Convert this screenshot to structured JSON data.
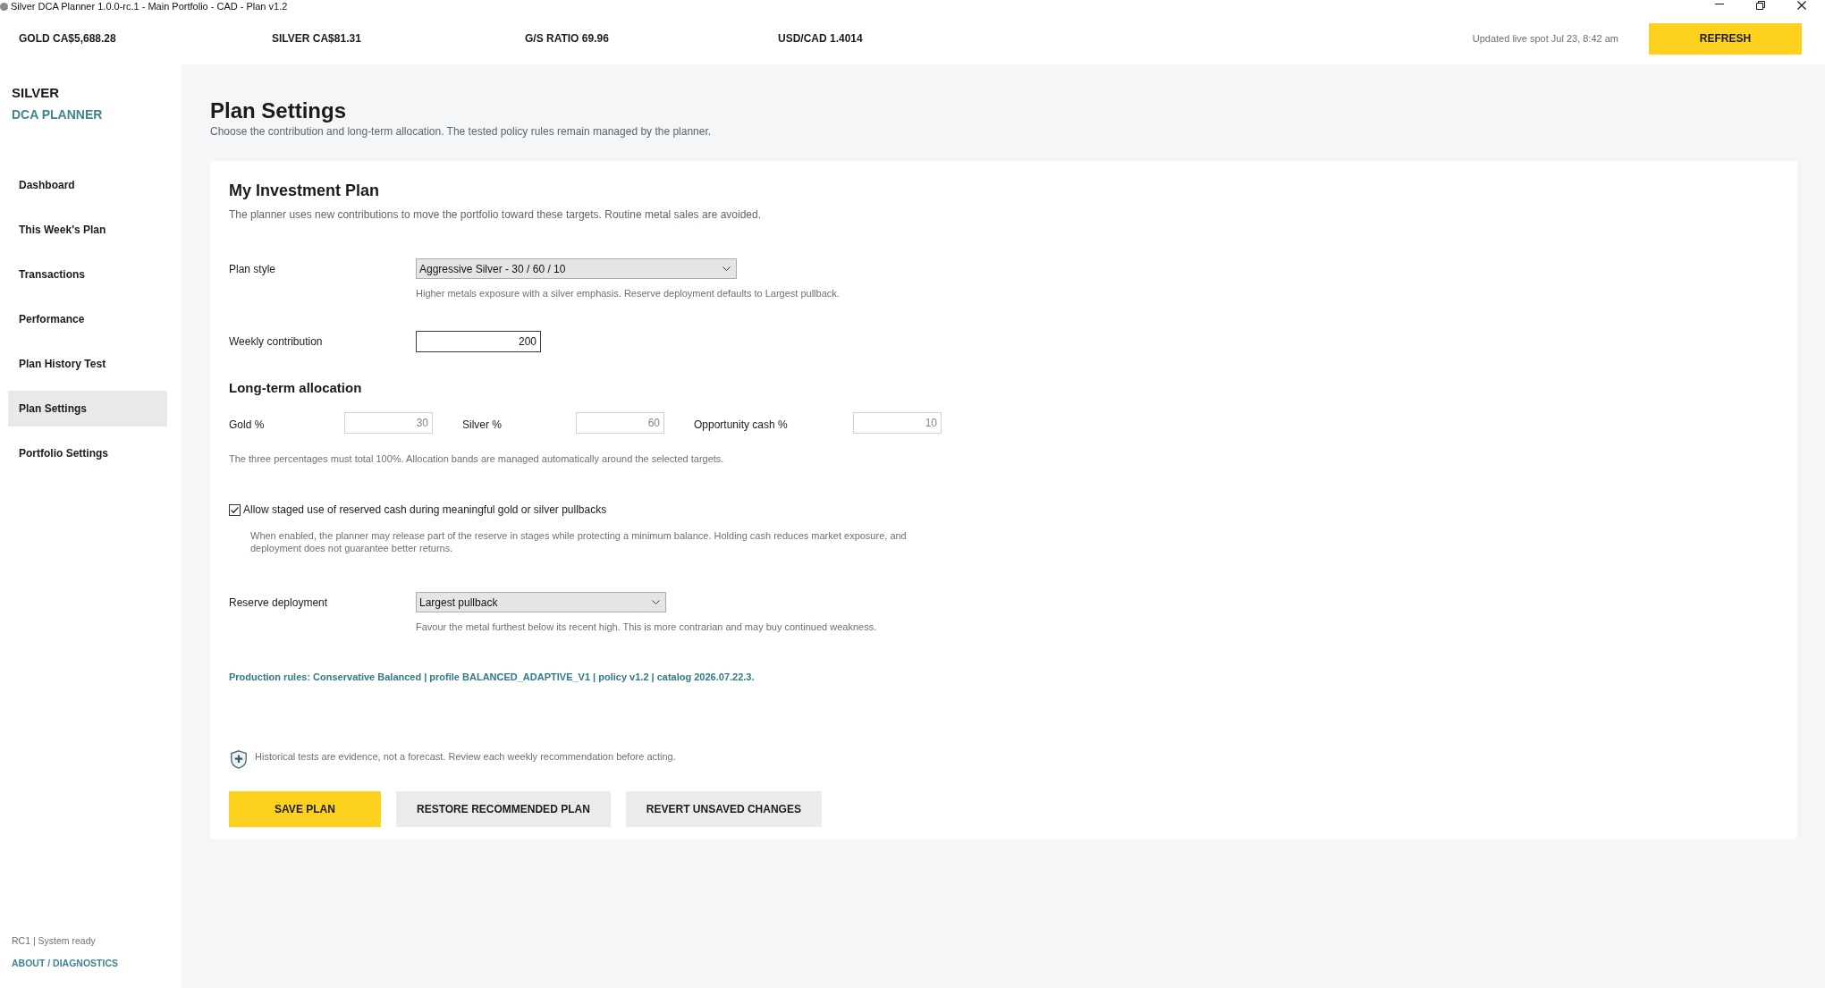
{
  "window": {
    "title": "Silver DCA Planner 1.0.0-rc.1 - Main Portfolio - CAD - Plan v1.2"
  },
  "ticker": {
    "quotes": [
      "GOLD CA$5,688.28",
      "SILVER CA$81.31",
      "G/S RATIO 69.96",
      "USD/CAD 1.4014"
    ],
    "updated": "Updated live spot Jul 23, 8:42 am",
    "refresh_button": "REFRESH"
  },
  "sidebar": {
    "brand": {
      "line_1": "SILVER",
      "line_2": "DCA PLANNER"
    },
    "items": [
      {
        "label": "Dashboard",
        "selected": false
      },
      {
        "label": "This Week's Plan",
        "selected": false
      },
      {
        "label": "Transactions",
        "selected": false
      },
      {
        "label": "Performance",
        "selected": false
      },
      {
        "label": "Plan History Test",
        "selected": false
      },
      {
        "label": "Plan Settings",
        "selected": true
      },
      {
        "label": "Portfolio Settings",
        "selected": false
      }
    ],
    "status": "RC1 | System ready",
    "about_link": "ABOUT / DIAGNOSTICS"
  },
  "page": {
    "title": "Plan Settings",
    "subtitle": "Choose the contribution and long-term allocation. The tested policy rules remain managed by the planner."
  },
  "plan_card": {
    "title": "My Investment Plan",
    "subtitle": "The planner uses new contributions to move the portfolio toward these targets. Routine metal sales are avoided.",
    "plan_style": {
      "label": "Plan style",
      "value": "Aggressive Silver - 30 / 60 / 10",
      "hint": "Higher metals exposure with a silver emphasis. Reserve deployment defaults to Largest pullback."
    },
    "weekly_contribution": {
      "label": "Weekly contribution",
      "value": "200"
    },
    "allocation": {
      "heading": "Long-term allocation",
      "fields": [
        {
          "label": "Gold %",
          "value": "30",
          "disabled": true
        },
        {
          "label": "Silver %",
          "value": "60",
          "disabled": true
        },
        {
          "label": "Opportunity cash %",
          "value": "10",
          "disabled": true
        }
      ],
      "note": "The three percentages must total 100%. Allocation bands are managed automatically around the selected targets."
    },
    "reserve_option": {
      "label": "Allow staged use of reserved cash during meaningful gold or silver pullbacks",
      "checked": true,
      "description": "When enabled, the planner may release part of the reserve in stages while protecting a minimum balance. Holding cash reduces market exposure, and deployment does not guarantee better returns."
    },
    "reserve_deployment": {
      "label": "Reserve deployment",
      "value": "Largest pullback",
      "hint": "Favour the metal furthest below its recent high. This is more contrarian and may buy continued weakness."
    },
    "production_rules": "Production rules: Conservative Balanced | profile BALANCED_ADAPTIVE_V1 | policy v1.2 | catalog 2026.07.22.3.",
    "disclaimer": "Historical tests are evidence, not a forecast. Review each weekly recommendation before acting.",
    "buttons": [
      {
        "label": "SAVE PLAN",
        "kind": "primary"
      },
      {
        "label": "RESTORE RECOMMENDED PLAN",
        "kind": "secondary"
      },
      {
        "label": "REVERT UNSAVED CHANGES",
        "kind": "secondary"
      }
    ]
  }
}
